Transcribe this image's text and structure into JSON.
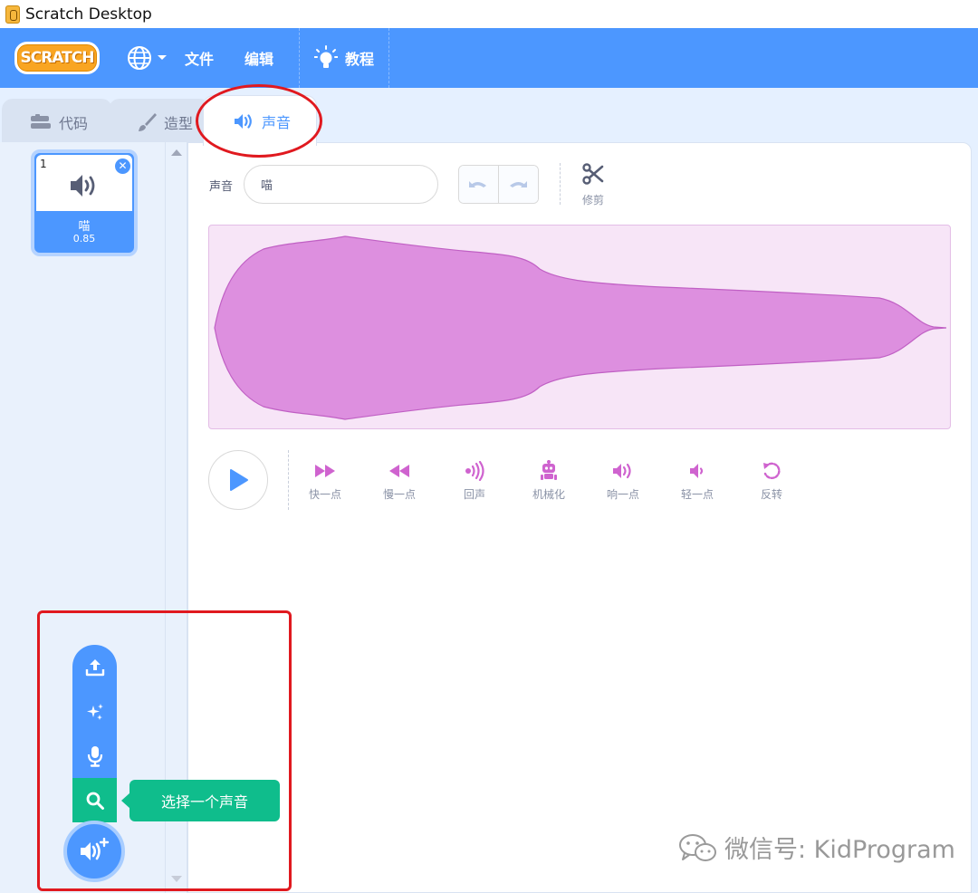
{
  "window": {
    "title": "Scratch Desktop"
  },
  "menubar": {
    "logo_text": "SCRATCH",
    "file": "文件",
    "edit": "编辑",
    "tutorials": "教程"
  },
  "tabs": [
    {
      "label": "代码",
      "active": false
    },
    {
      "label": "造型",
      "active": false
    },
    {
      "label": "声音",
      "active": true
    }
  ],
  "sound_list": [
    {
      "index": "1",
      "name": "喵",
      "duration": "0.85",
      "selected": true
    }
  ],
  "editor": {
    "sound_label": "声音",
    "sound_name": "喵",
    "trim_label": "修剪"
  },
  "effects": [
    {
      "label": "快一点",
      "icon": "faster-icon"
    },
    {
      "label": "慢一点",
      "icon": "slower-icon"
    },
    {
      "label": "回声",
      "icon": "echo-icon"
    },
    {
      "label": "机械化",
      "icon": "robot-icon"
    },
    {
      "label": "响一点",
      "icon": "louder-icon"
    },
    {
      "label": "轻一点",
      "icon": "softer-icon"
    },
    {
      "label": "反转",
      "icon": "reverse-icon"
    }
  ],
  "add_sound_menu": {
    "tooltip": "选择一个声音",
    "items": [
      "upload-icon",
      "surprise-icon",
      "record-icon",
      "search-icon"
    ]
  },
  "watermark": "微信号: KidProgram",
  "colors": {
    "menubar": "#4c97ff",
    "accent": "#4c97ff",
    "waveform_fill": "#dd8fdf",
    "waveform_bg": "#f7e5f7",
    "effect_icon": "#cf63cf",
    "choose_green": "#0fbd8c",
    "annotation_red": "#e0191f"
  }
}
